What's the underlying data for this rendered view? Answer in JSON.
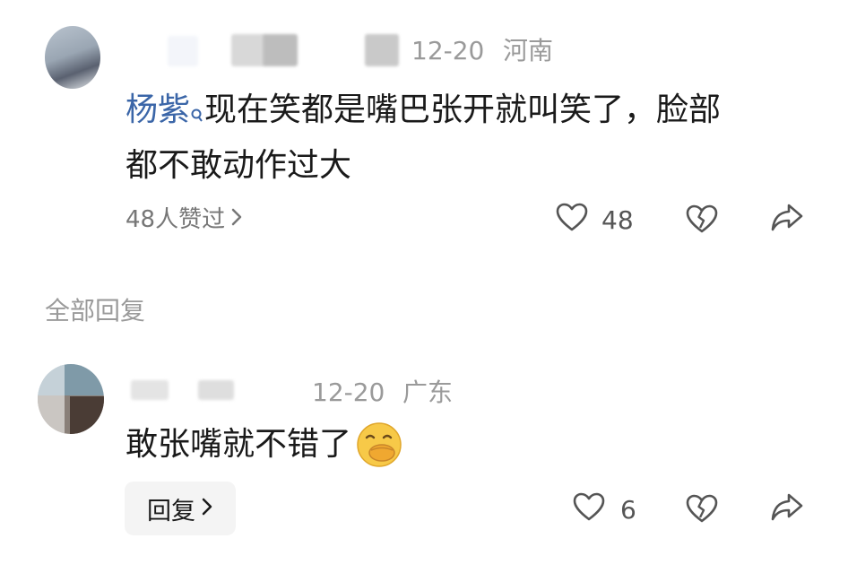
{
  "comment": {
    "date": "12-20",
    "location": "河南",
    "mention": "杨紫",
    "text_line1": "现在笑都是嘴巴张开就叫笑了，脸部",
    "text_line2": "都不敢动作过大",
    "likes_summary": "48人赞过",
    "like_count": "48"
  },
  "section_title": "全部回复",
  "reply": {
    "date": "12-20",
    "location": "广东",
    "text": "敢张嘴就不错了",
    "emoji": "🤭",
    "reply_button_label": "回复",
    "like_count": "6"
  },
  "icons": {
    "like": "heart-outline-icon",
    "dislike": "broken-heart-icon",
    "share": "share-arrow-icon",
    "mention_marker": "search-small-icon",
    "chevron": "chevron-right-icon"
  }
}
